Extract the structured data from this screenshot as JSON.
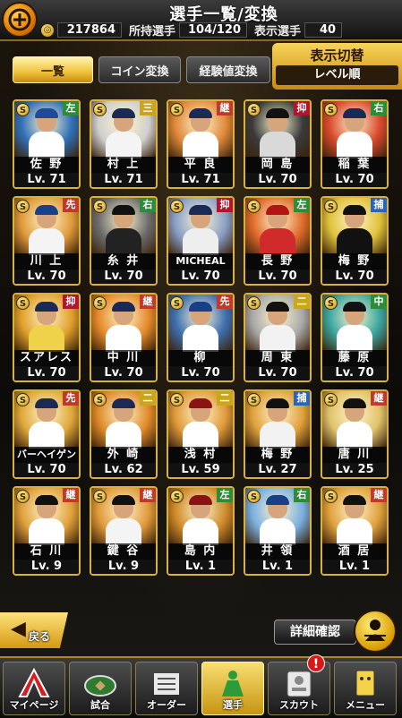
{
  "header": {
    "title": "選手一覧/変換",
    "coins": "217864",
    "owned_label": "所持選手",
    "owned_value": "104/120",
    "shown_label": "表示選手",
    "shown_value": "40"
  },
  "tabs": {
    "list": "一覧",
    "coin_convert": "コイン変換",
    "exp_convert": "経験値変換"
  },
  "switch": {
    "title": "表示切替",
    "sort": "レベル順"
  },
  "players": [
    {
      "name": "佐 野",
      "level": "Lv. 71",
      "pos": "左",
      "pos_color": "#2e8b3a",
      "bg": "#2f6fb7",
      "uniform": "#ffffff",
      "cap": "#1f4a99"
    },
    {
      "name": "村 上",
      "level": "Lv. 71",
      "pos": "三",
      "pos_color": "#c9a61c",
      "bg": "#cfcfcf",
      "uniform": "#f4f4f4",
      "cap": "#1b2a55"
    },
    {
      "name": "平 良",
      "level": "Lv. 71",
      "pos": "継",
      "pos_color": "#c0392b",
      "bg": "#e0893a",
      "uniform": "#ffffff",
      "cap": "#1b2a55"
    },
    {
      "name": "岡 島",
      "level": "Lv. 70",
      "pos": "抑",
      "pos_color": "#b0172f",
      "bg": "#3a3a3a",
      "uniform": "#d9d9d9",
      "cap": "#111111"
    },
    {
      "name": "稲 葉",
      "level": "Lv. 70",
      "pos": "右",
      "pos_color": "#2e8b3a",
      "bg": "#d94a2c",
      "uniform": "#ffffff",
      "cap": "#1b2a55"
    },
    {
      "name": "川 上",
      "level": "Lv. 70",
      "pos": "先",
      "pos_color": "#c0392b",
      "bg": "#e09a3a",
      "uniform": "#f4f4f4",
      "cap": "#1a3f8a"
    },
    {
      "name": "糸 井",
      "level": "Lv. 70",
      "pos": "右",
      "pos_color": "#2e8b3a",
      "bg": "#6b6b6b",
      "uniform": "#222222",
      "cap": "#111111"
    },
    {
      "name": "MICHEAL",
      "level": "Lv. 70",
      "pos": "抑",
      "pos_color": "#b0172f",
      "bg": "#8aa0c8",
      "uniform": "#eeeeee",
      "cap": "#1b2a55"
    },
    {
      "name": "長 野",
      "level": "Lv. 70",
      "pos": "左",
      "pos_color": "#2e8b3a",
      "bg": "#e06a2a",
      "uniform": "#d12a2a",
      "cap": "#b31414"
    },
    {
      "name": "梅 野",
      "level": "Lv. 70",
      "pos": "捕",
      "pos_color": "#2a64b8",
      "bg": "#e0c23a",
      "uniform": "#111111",
      "cap": "#111111"
    },
    {
      "name": "スアレス",
      "level": "Lv. 70",
      "pos": "抑",
      "pos_color": "#b0172f",
      "bg": "#e0a02a",
      "uniform": "#f0d24a",
      "cap": "#1b2a55"
    },
    {
      "name": "中 川",
      "level": "Lv. 70",
      "pos": "継",
      "pos_color": "#c0392b",
      "bg": "#e58a2a",
      "uniform": "#ffffff",
      "cap": "#1b2a55"
    },
    {
      "name": "柳",
      "level": "Lv. 70",
      "pos": "先",
      "pos_color": "#c0392b",
      "bg": "#3d6fb0",
      "uniform": "#ffffff",
      "cap": "#1a3f8a"
    },
    {
      "name": "周 東",
      "level": "Lv. 70",
      "pos": "二",
      "pos_color": "#c9a61c",
      "bg": "#a8a8a8",
      "uniform": "#f2f2f2",
      "cap": "#111111"
    },
    {
      "name": "藤 原",
      "level": "Lv. 70",
      "pos": "中",
      "pos_color": "#2e8b3a",
      "bg": "#3aa6a0",
      "uniform": "#ffffff",
      "cap": "#111111"
    },
    {
      "name": "バーヘイゲン",
      "level": "Lv. 70",
      "pos": "先",
      "pos_color": "#c0392b",
      "bg": "#e0a83a",
      "uniform": "#ffffff",
      "cap": "#1b2a55"
    },
    {
      "name": "外 崎",
      "level": "Lv. 62",
      "pos": "二",
      "pos_color": "#c9a61c",
      "bg": "#e08a2a",
      "uniform": "#ffffff",
      "cap": "#1b2a55"
    },
    {
      "name": "浅 村",
      "level": "Lv. 59",
      "pos": "二",
      "pos_color": "#c9a61c",
      "bg": "#e09a3a",
      "uniform": "#ffffff",
      "cap": "#8a1414"
    },
    {
      "name": "梅 野",
      "level": "Lv. 27",
      "pos": "捕",
      "pos_color": "#2a64b8",
      "bg": "#e0a03a",
      "uniform": "#f2f2f2",
      "cap": "#111111"
    },
    {
      "name": "唐 川",
      "level": "Lv. 25",
      "pos": "継",
      "pos_color": "#c0392b",
      "bg": "#e0c26a",
      "uniform": "#ffffff",
      "cap": "#111111"
    },
    {
      "name": "石 川",
      "level": "Lv. 9",
      "pos": "継",
      "pos_color": "#c0392b",
      "bg": "#e0a03a",
      "uniform": "#ffffff",
      "cap": "#111111"
    },
    {
      "name": "鍵 谷",
      "level": "Lv. 9",
      "pos": "継",
      "pos_color": "#c0392b",
      "bg": "#e09a3a",
      "uniform": "#f4f4f4",
      "cap": "#111111"
    },
    {
      "name": "島 内",
      "level": "Lv. 1",
      "pos": "左",
      "pos_color": "#2e8b3a",
      "bg": "#d08a2a",
      "uniform": "#ffffff",
      "cap": "#8a1414"
    },
    {
      "name": "井 領",
      "level": "Lv. 1",
      "pos": "右",
      "pos_color": "#2e8b3a",
      "bg": "#7ab0e0",
      "uniform": "#ffffff",
      "cap": "#1a3f8a"
    },
    {
      "name": "酒 居",
      "level": "Lv. 1",
      "pos": "継",
      "pos_color": "#c0392b",
      "bg": "#e0a03a",
      "uniform": "#ffffff",
      "cap": "#111111"
    }
  ],
  "bottom": {
    "back": "戻る",
    "detail": "詳細確認"
  },
  "nav": {
    "items": [
      {
        "label": "マイページ",
        "icon": "home-a-icon"
      },
      {
        "label": "試合",
        "icon": "stadium-icon"
      },
      {
        "label": "オーダー",
        "icon": "lineup-icon"
      },
      {
        "label": "選手",
        "icon": "player-icon"
      },
      {
        "label": "スカウト",
        "icon": "scout-icon"
      },
      {
        "label": "メニュー",
        "icon": "menu-icon"
      }
    ],
    "badge": "!"
  }
}
